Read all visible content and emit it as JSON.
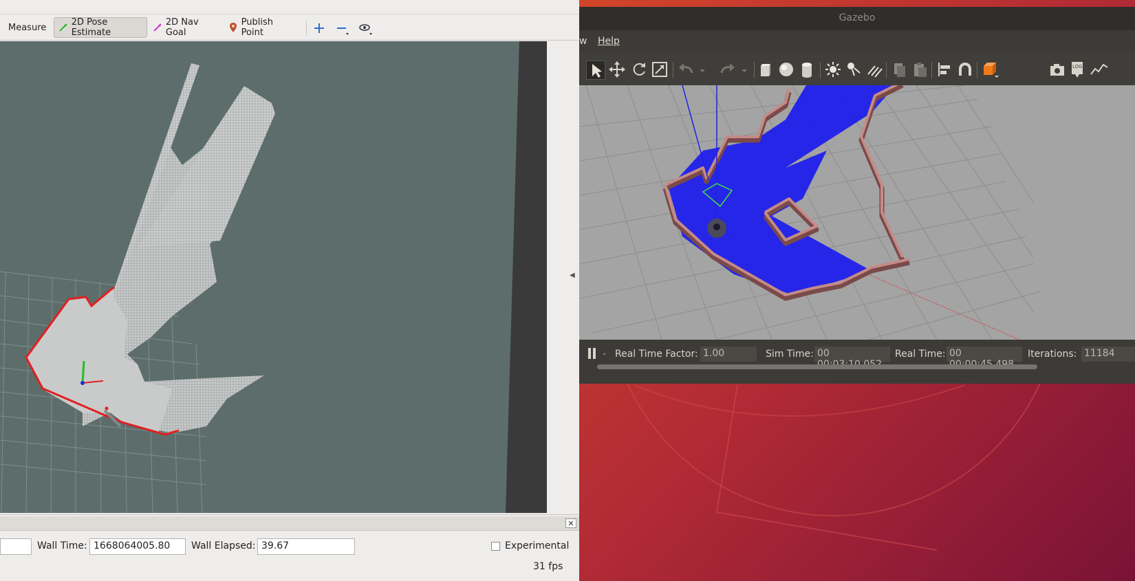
{
  "rviz": {
    "toolbar": {
      "measure": "Measure",
      "pose_estimate": "2D Pose Estimate",
      "nav_goal": "2D Nav Goal",
      "publish_point": "Publish Point"
    },
    "time_panel": {
      "wall_time_label": "Wall Time:",
      "wall_time_value": "1668064005.80",
      "wall_elapsed_label": "Wall Elapsed:",
      "wall_elapsed_value": "39.67",
      "experimental_label": "Experimental",
      "fps": "31 fps",
      "close_glyph": "✕"
    }
  },
  "gazebo": {
    "title": "Gazebo",
    "menu": {
      "view_partial": "w",
      "help": "Help"
    },
    "status": {
      "real_time_factor_label": "Real Time Factor:",
      "real_time_factor_value": "1.00",
      "sim_time_label": "Sim Time:",
      "sim_time_value": "00 00:03:10.052",
      "real_time_label": "Real Time:",
      "real_time_value": "00 00:00:45.498",
      "iterations_label": "Iterations:",
      "iterations_value": "11184"
    }
  }
}
